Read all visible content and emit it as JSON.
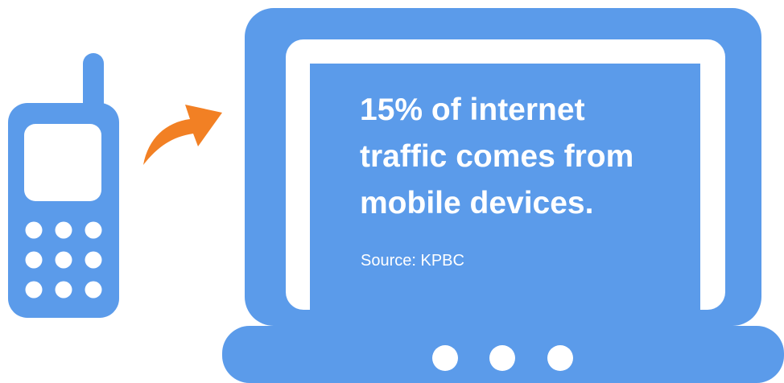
{
  "colors": {
    "device_blue": "#5b9bea",
    "arrow_orange": "#f28024",
    "background": "#ffffff"
  },
  "icons": [
    "mobile-phone-icon",
    "curved-arrow-icon",
    "laptop-icon"
  ],
  "stat": {
    "headline_lines": [
      "15% of internet",
      "traffic comes from",
      "mobile devices."
    ],
    "source": "Source: KPBC"
  }
}
